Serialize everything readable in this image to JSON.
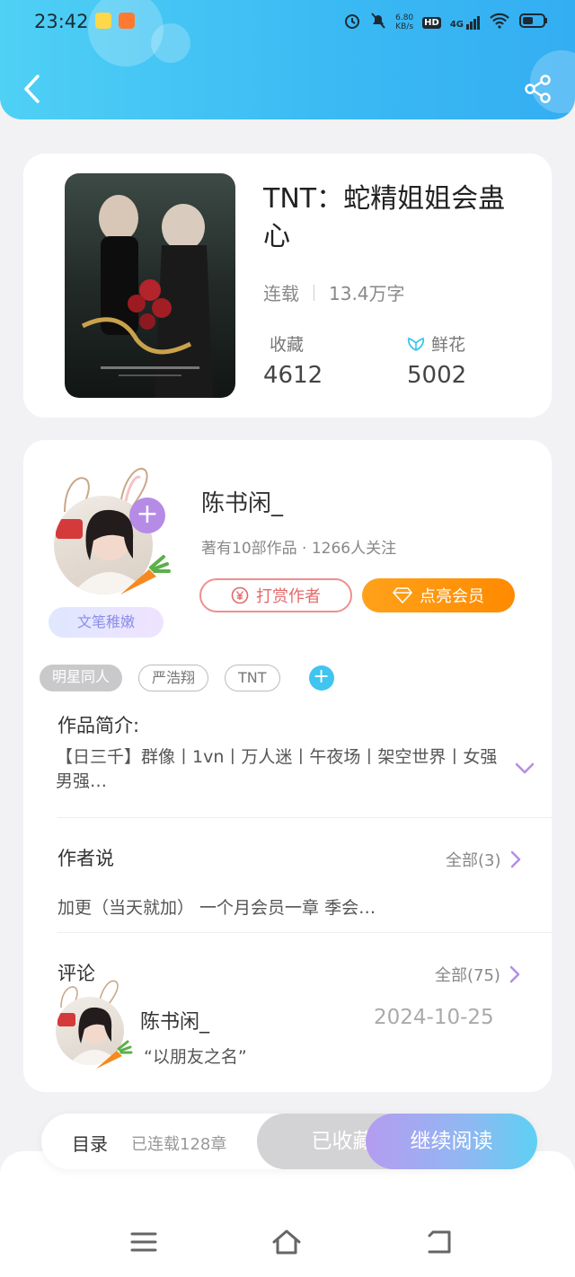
{
  "status_bar": {
    "time": "23:42",
    "net_speed_value": "6.80",
    "net_speed_unit": "KB/s",
    "hd": "HD",
    "network": "4G"
  },
  "book": {
    "title": "TNT：蛇精姐姐会蛊心",
    "status": "连载",
    "word_count": "13.4万字",
    "favorites_label": "收藏",
    "favorites_count": "4612",
    "flowers_label": "鲜花",
    "flowers_count": "5002"
  },
  "author": {
    "name": "陈书闲_",
    "stats": "著有10部作品 · 1266人关注",
    "level_badge": "文笔稚嫩",
    "tip_button": "打赏作者",
    "vip_button": "点亮会员"
  },
  "tags": [
    "明星同人",
    "严浩翔",
    "TNT"
  ],
  "intro": {
    "title": "作品简介:",
    "text": "【日三千】群像丨1vn丨万人迷丨午夜场丨架空世界丨女强男强…"
  },
  "author_notes": {
    "title": "作者说",
    "all_link": "全部(3)",
    "text": "加更（当天就加） 一个月会员一章 季会…"
  },
  "comments": {
    "title": "评论",
    "all_link": "全部(75)",
    "items": [
      {
        "name": "陈书闲_",
        "date": "2024-10-25",
        "text": "“以朋友之名”"
      }
    ]
  },
  "bottom_bar": {
    "toc_label": "目录",
    "chapter_count": "已连载128章",
    "saved_button": "已收藏",
    "read_button": "继续阅读"
  },
  "colors": {
    "header_gradient": [
      "#4fd0f5",
      "#34aef2"
    ],
    "vip_orange": "#ff8a00",
    "tip_red": "#e36a6a",
    "accent_purple": "#b68be6",
    "accent_cyan": "#3fc5f0"
  }
}
